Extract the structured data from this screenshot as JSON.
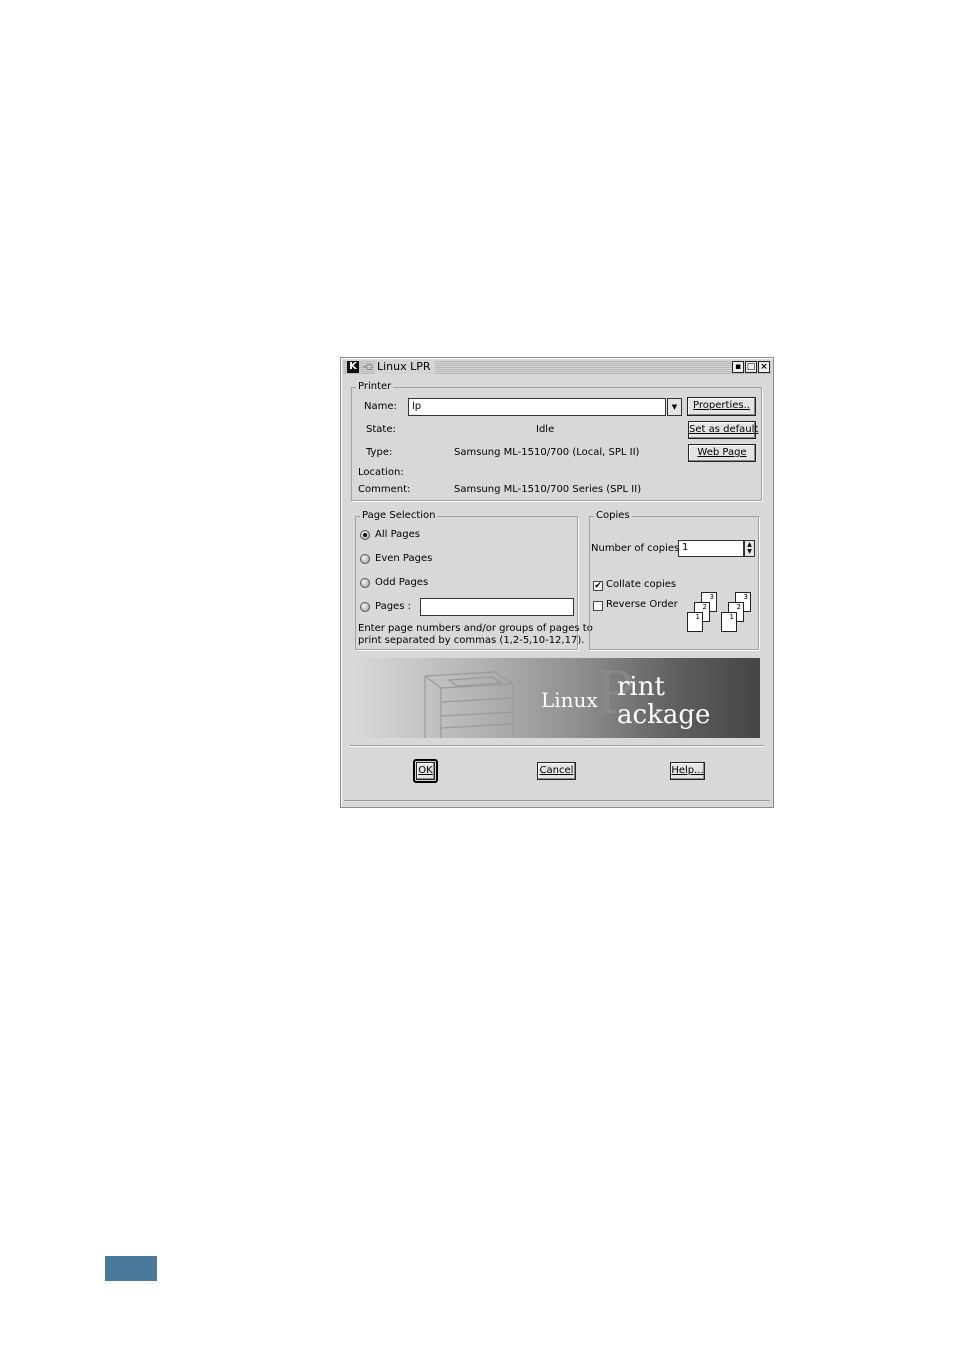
{
  "window": {
    "title": "Linux LPR",
    "icon": "kde-k-icon",
    "controls": [
      "minimize-icon",
      "maximize-icon",
      "close-icon"
    ]
  },
  "printer": {
    "legend": "Printer",
    "name_label": "Name:",
    "name_value": "lp",
    "state_label": "State:",
    "state_value": "Idle",
    "type_label": "Type:",
    "type_value": "Samsung ML-1510/700 (Local, SPL II)",
    "location_label": "Location:",
    "location_value": "",
    "comment_label": "Comment:",
    "comment_value": "Samsung ML-1510/700 Series (SPL II)",
    "properties_button": "Properties..",
    "set_default_button": "Set as default",
    "web_page_button": "Web Page"
  },
  "page_selection": {
    "legend": "Page Selection",
    "all_pages": "All Pages",
    "even_pages": "Even Pages",
    "odd_pages": "Odd Pages",
    "pages": "Pages :",
    "pages_value": "",
    "help_line1": "Enter page numbers and/or groups of pages to",
    "help_line2": "print separated by commas (1,2-5,10-12,17).",
    "selected": "all"
  },
  "copies": {
    "legend": "Copies",
    "number_label": "Number of copies:",
    "number_value": "1",
    "collate_label": "Collate copies",
    "collate_checked": true,
    "reverse_label": "Reverse Order",
    "reverse_checked": false,
    "collate_sheets": [
      "3",
      "2",
      "1",
      "3",
      "2",
      "1"
    ]
  },
  "banner": {
    "linux": "Linux",
    "big_p": "P",
    "print": "rint",
    "package": "ackage"
  },
  "actions": {
    "ok": "OK",
    "cancel": "Cancel",
    "help": "Help..."
  },
  "colors": {
    "page_tab": "#4a7a9b",
    "window_bg": "#d8d8d8"
  }
}
